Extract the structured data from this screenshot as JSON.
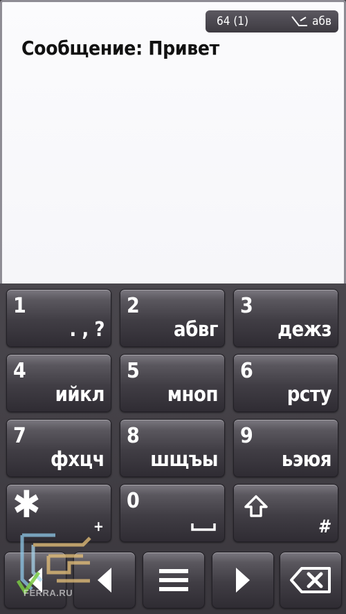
{
  "status": {
    "char_counter": "64 (1)",
    "input_mode": "абв"
  },
  "message": {
    "label": "Сообщение:",
    "text": "Привет"
  },
  "keys": [
    {
      "digit": "1",
      "letters": ". , ?"
    },
    {
      "digit": "2",
      "letters": "абвг"
    },
    {
      "digit": "3",
      "letters": "дежз"
    },
    {
      "digit": "4",
      "letters": "ийкл"
    },
    {
      "digit": "5",
      "letters": "мноп"
    },
    {
      "digit": "6",
      "letters": "рсту"
    },
    {
      "digit": "7",
      "letters": "фхцч"
    },
    {
      "digit": "8",
      "letters": "шщъы"
    },
    {
      "digit": "9",
      "letters": "ьэюя"
    },
    {
      "digit": "*",
      "letters": "+"
    },
    {
      "digit": "0",
      "letters": "space"
    },
    {
      "digit": "shift",
      "letters": "#"
    }
  ],
  "icons": {
    "star_key": "asterisk-icon",
    "zero_key": "space-bar-icon",
    "shift_key": "shift-arrow-icon",
    "nav": [
      "left-arrow-icon",
      "left-arrow-icon",
      "menu-icon",
      "right-arrow-icon",
      "backspace-icon"
    ]
  },
  "watermark": {
    "text": "FERRA.RU"
  },
  "colors": {
    "key_text": "#ffffff",
    "editor_bg": "#f7f7fa",
    "keypad_bg": "#3a373d"
  }
}
